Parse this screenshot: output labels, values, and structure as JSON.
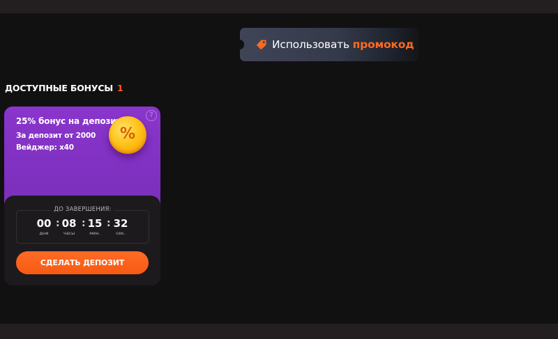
{
  "promo": {
    "label_prefix": "Использовать ",
    "label_highlight": "промокод",
    "icon": "tag-icon"
  },
  "section": {
    "title": "ДОСТУПНЫЕ БОНУСЫ",
    "count": "1"
  },
  "bonus_card": {
    "title": "25% бонус на депозит",
    "line1": "За депозит от 2000",
    "line2": "Вейджер: x40",
    "help_icon_glyph": "?",
    "coin_icon": "percent-coin-icon",
    "coin_glyph": "%",
    "timer": {
      "caption": "ДО ЗАВЕРШЕНИЯ:",
      "units": [
        {
          "value": "00",
          "label": "дни"
        },
        {
          "value": "08",
          "label": "часы"
        },
        {
          "value": "15",
          "label": "мин."
        },
        {
          "value": "32",
          "label": "сек."
        }
      ],
      "separator": ":"
    },
    "button_label": "СДЕЛАТЬ ДЕПОЗИТ"
  },
  "colors": {
    "background": "#121112",
    "accent_orange": "#ff6a1f",
    "card_purple": "#8a35cc",
    "card_dark": "#1c1a1d"
  }
}
